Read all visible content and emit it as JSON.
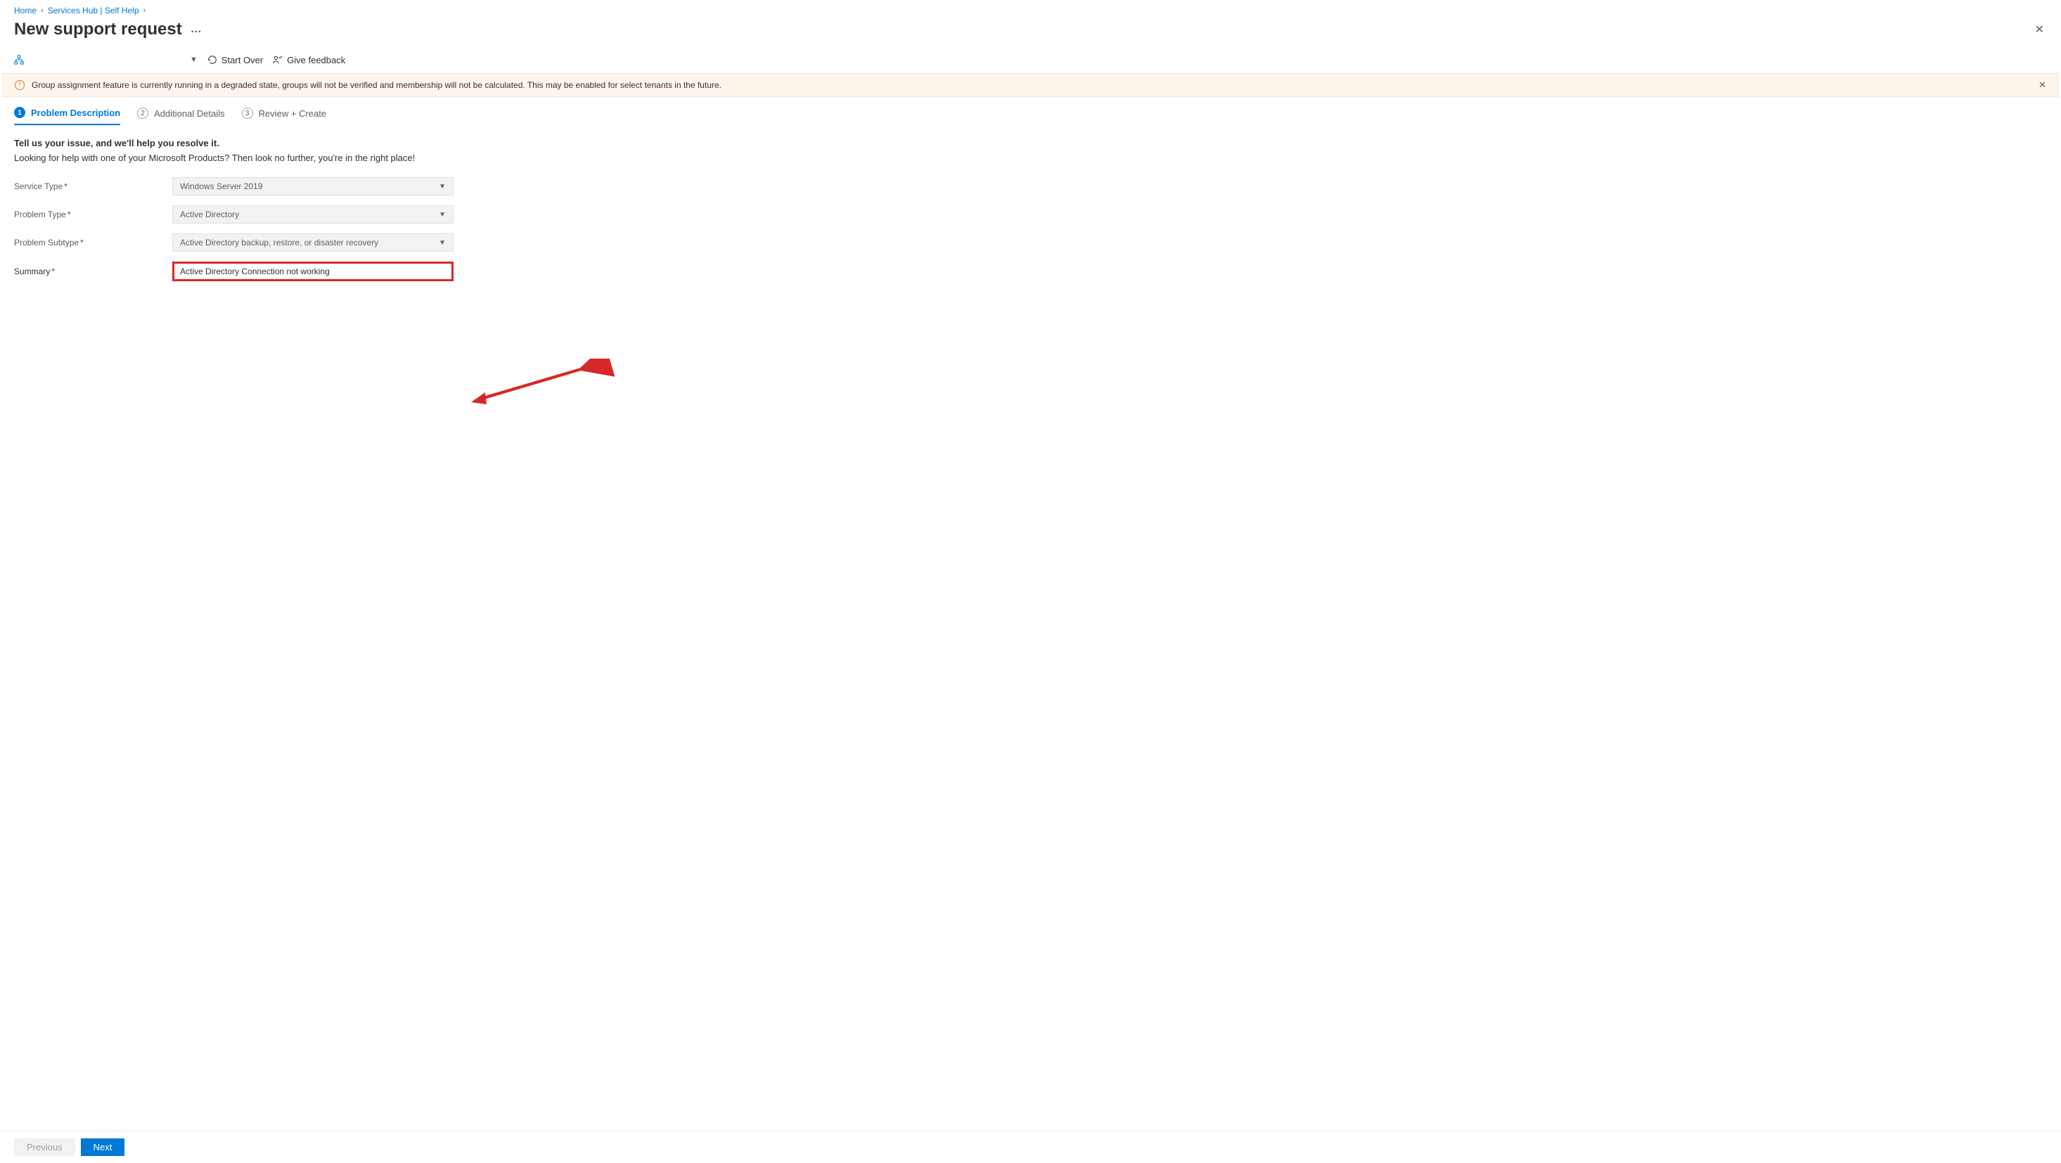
{
  "breadcrumb": {
    "home": "Home",
    "hub": "Services Hub | Self Help"
  },
  "title": "New support request",
  "toolbar": {
    "start_over": "Start Over",
    "feedback": "Give feedback"
  },
  "banner": {
    "text": "Group assignment feature is currently running in a degraded state, groups will not be verified and membership will not be calculated. This may be enabled for select tenants in the future."
  },
  "tabs": {
    "t1_num": "1",
    "t1_label": "Problem Description",
    "t2_num": "2",
    "t2_label": "Additional Details",
    "t3_num": "3",
    "t3_label": "Review + Create"
  },
  "content": {
    "heading": "Tell us your issue, and we'll help you resolve it.",
    "subheading": "Looking for help with one of your Microsoft Products? Then look no further, you're in the right place!",
    "fields": {
      "service_type_label": "Service Type",
      "service_type_value": "Windows Server 2019",
      "problem_type_label": "Problem Type",
      "problem_type_value": "Active Directory",
      "problem_subtype_label": "Problem Subtype",
      "problem_subtype_value": "Active Directory backup, restore, or disaster recovery",
      "summary_label": "Summary",
      "summary_value": "Active Directory Connection not working"
    }
  },
  "footer": {
    "prev": "Previous",
    "next": "Next"
  }
}
